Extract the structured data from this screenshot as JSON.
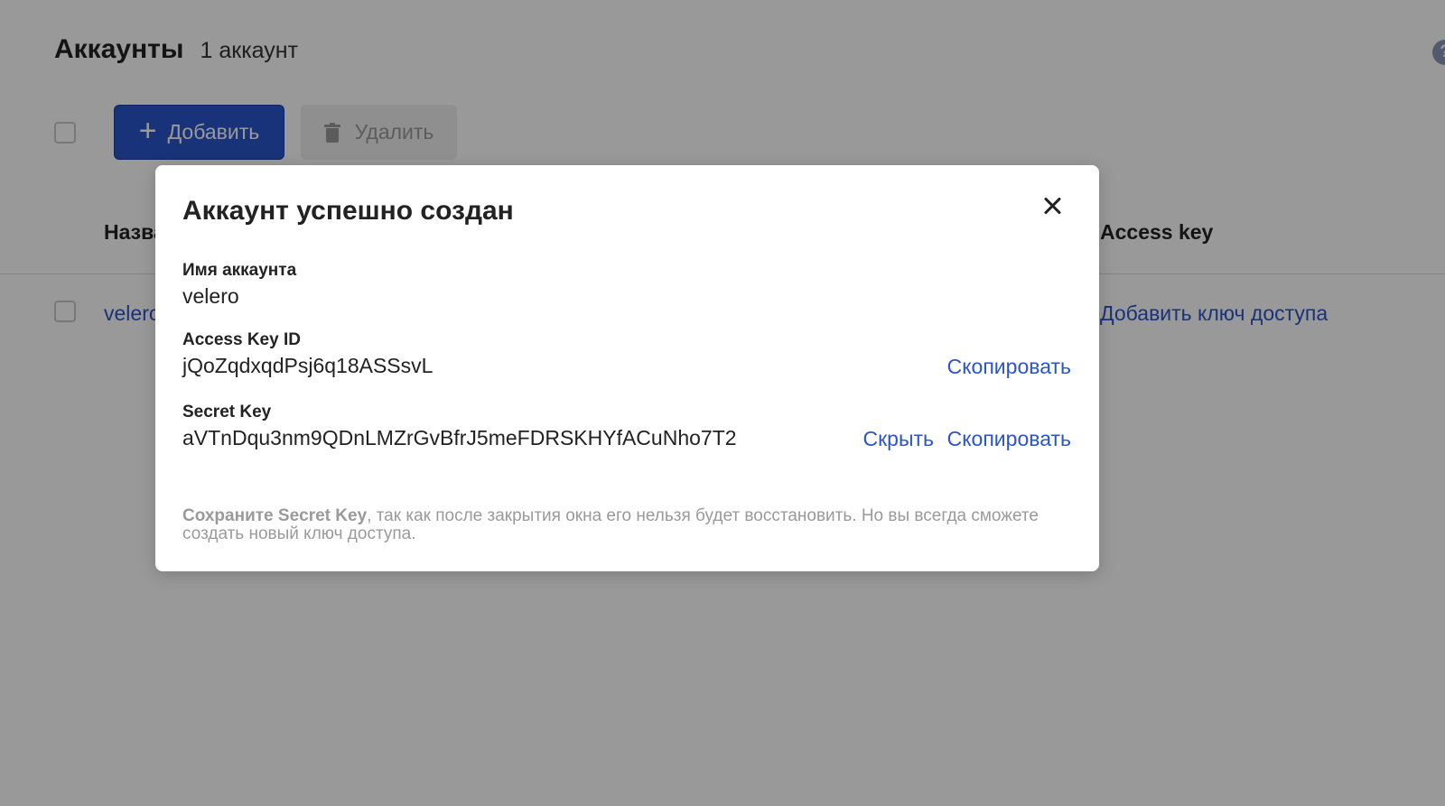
{
  "page": {
    "title": "Аккаунты",
    "count": "1 аккаунт",
    "help_glyph": "?"
  },
  "toolbar": {
    "add_label": "Добавить",
    "add_icon": "+",
    "delete_label": "Удалить"
  },
  "table": {
    "columns": {
      "name": "Название",
      "access_key": "Access key"
    },
    "rows": [
      {
        "name": "velero",
        "access_key_action": "Добавить ключ доступа"
      }
    ]
  },
  "modal": {
    "title": "Аккаунт успешно создан",
    "account_name_label": "Имя аккаунта",
    "account_name": "velero",
    "access_key_id_label": "Access Key ID",
    "access_key_id": "jQoZqdxqdPsj6q18ASSsvL",
    "secret_key_label": "Secret Key",
    "secret_key": "aVTnDqu3nm9QDnLMZrGvBfrJ5meFDRSKHYfACuNho7T2",
    "copy_label": "Скопировать",
    "hide_label": "Скрыть",
    "note_bold": "Сохраните Secret Key",
    "note_rest": ", так как после закрытия окна его нельзя будет восстановить. Но вы всегда сможете создать новый ключ доступа."
  },
  "colors": {
    "accent": "#2a55cc",
    "overlay": "rgba(0,0,0,0.40)",
    "muted_text": "#9a9a9a"
  }
}
